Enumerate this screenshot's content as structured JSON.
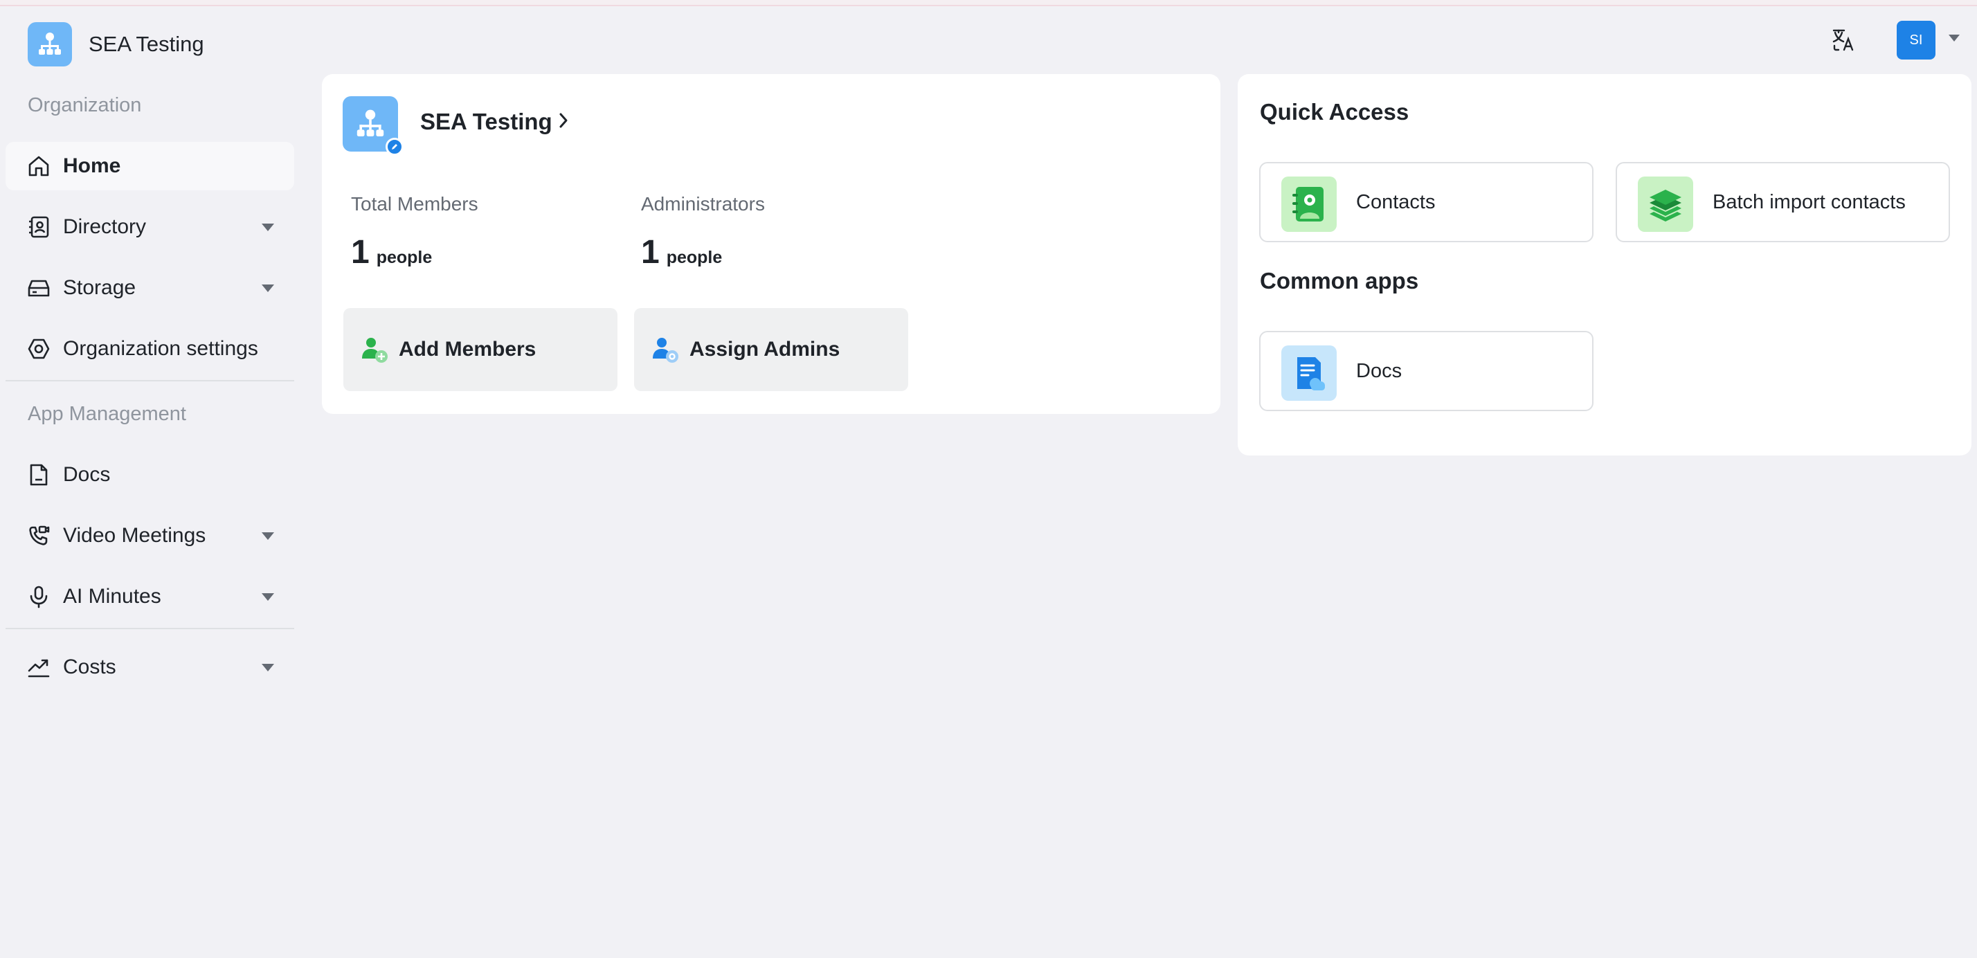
{
  "header": {
    "org_name": "SEA Testing",
    "translate_icon": "translate-icon",
    "avatar_initials": "SI"
  },
  "sidebar": {
    "groups": [
      "Organization",
      "App Management"
    ],
    "items": [
      {
        "label": "Home",
        "icon": "home-icon",
        "active": true
      },
      {
        "label": "Directory",
        "icon": "contacts-book-icon",
        "expandable": true
      },
      {
        "label": "Storage",
        "icon": "storage-drive-icon",
        "expandable": true
      },
      {
        "label": "Organization settings",
        "icon": "settings-icon"
      },
      {
        "label": "Docs",
        "icon": "document-icon"
      },
      {
        "label": "Video Meetings",
        "icon": "video-call-icon",
        "expandable": true
      },
      {
        "label": "AI Minutes",
        "icon": "microphone-icon",
        "expandable": true
      },
      {
        "label": "Costs",
        "icon": "trend-chart-icon",
        "expandable": true
      }
    ]
  },
  "org": {
    "title": "SEA Testing",
    "stats": [
      {
        "label": "Total Members",
        "value": "1",
        "unit": "people"
      },
      {
        "label": "Administrators",
        "value": "1",
        "unit": "people"
      }
    ],
    "actions": [
      {
        "label": "Add Members",
        "icon": "add-user-icon"
      },
      {
        "label": "Assign Admins",
        "icon": "admin-user-icon"
      }
    ]
  },
  "quick_access": {
    "heading": "Quick Access",
    "tiles": [
      {
        "label": "Contacts",
        "icon": "contacts-app-icon"
      },
      {
        "label": "Batch import contacts",
        "icon": "layers-import-icon"
      }
    ]
  },
  "common_apps": {
    "heading": "Common apps",
    "tiles": [
      {
        "label": "Docs",
        "icon": "docs-app-icon"
      }
    ]
  },
  "colors": {
    "accent": "#1e82e6",
    "brand_logo": "#6fb7f7",
    "background": "#f1f1f5"
  }
}
